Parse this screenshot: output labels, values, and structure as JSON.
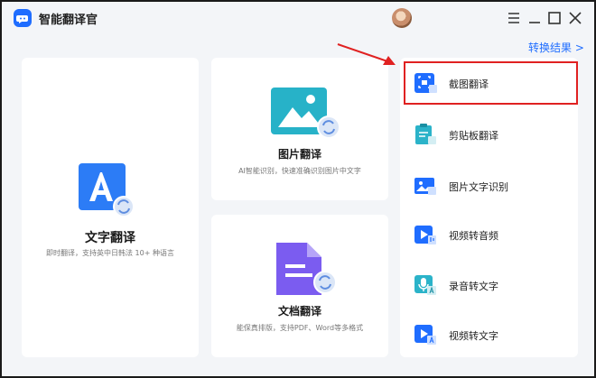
{
  "app": {
    "title": "智能翻译官",
    "logo_icon": "speech-bubble-icon"
  },
  "window_controls": {
    "menu_icon": "hamburger-menu-icon",
    "minimize_icon": "minimize-icon",
    "maximize_icon": "maximize-icon",
    "close_icon": "close-icon"
  },
  "header": {
    "result_link": "转换结果 >"
  },
  "cards": {
    "text": {
      "title": "文字翻译",
      "desc": "即时翻译，支持英中日韩法 10+ 种语言",
      "icon": "letter-a-document-icon"
    },
    "image": {
      "title": "图片翻译",
      "desc": "AI智能识别，快速准确识别图片中文字",
      "icon": "image-mountain-icon"
    },
    "doc": {
      "title": "文档翻译",
      "desc": "能保真排版，支持PDF、Word等多格式",
      "icon": "document-lines-icon"
    }
  },
  "tools": [
    {
      "label": "截图翻译",
      "icon": "screenshot-translate-icon",
      "active": true
    },
    {
      "label": "剪贴板翻译",
      "icon": "clipboard-translate-icon",
      "active": false
    },
    {
      "label": "图片文字识别",
      "icon": "image-ocr-icon",
      "active": false
    },
    {
      "label": "视频转音频",
      "icon": "video-to-audio-icon",
      "active": false
    },
    {
      "label": "录音转文字",
      "icon": "recording-to-text-icon",
      "active": false
    },
    {
      "label": "视频转文字",
      "icon": "video-to-text-icon",
      "active": false
    }
  ],
  "colors": {
    "accent": "#1f6dff",
    "highlight_border": "#e02121",
    "doc_purple": "#7b5cf0",
    "image_teal": "#2bb3c9"
  }
}
